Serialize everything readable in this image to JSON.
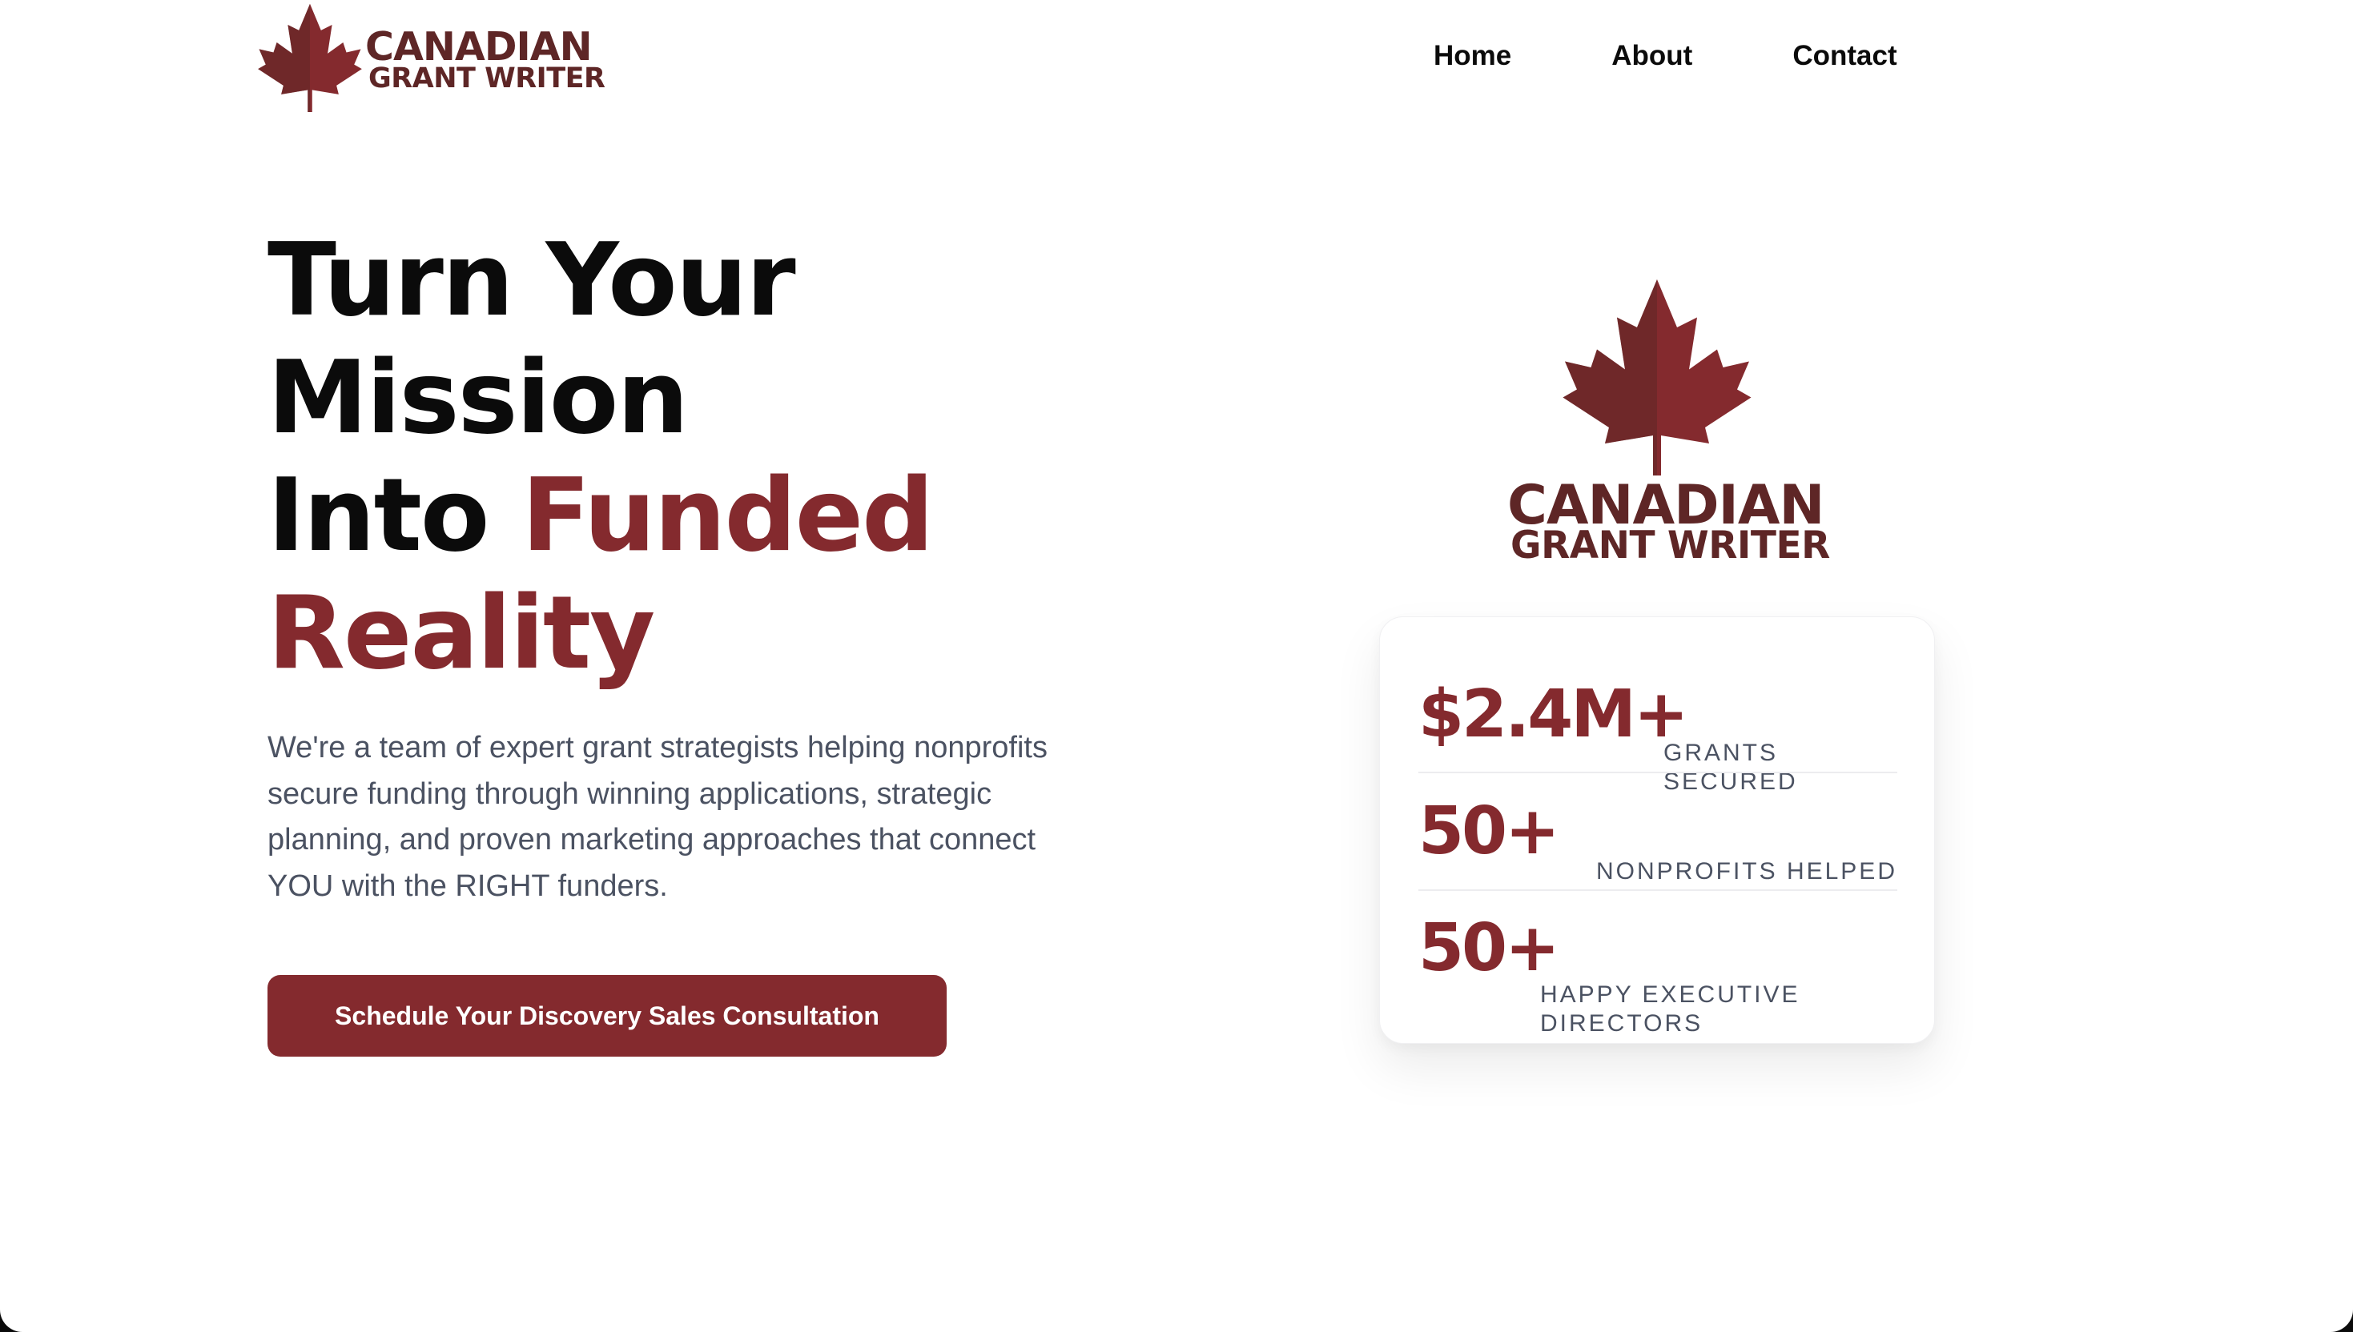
{
  "brand": {
    "name_line1": "CANADIAN",
    "name_line2": "GRANT WRITER",
    "accent_color": "#842a2e",
    "dark_red": "#5e2626",
    "icon": "maple-leaf-icon"
  },
  "nav": {
    "items": [
      {
        "label": "Home"
      },
      {
        "label": "About"
      },
      {
        "label": "Contact"
      }
    ]
  },
  "hero": {
    "title_line1": "Turn Your",
    "title_line2": "Mission",
    "title_line3_prefix": "Into ",
    "title_line3_accent": "Funded",
    "title_line4_accent": "Reality",
    "description": "We're a team of expert grant strategists helping nonprofits secure funding through winning applications, strategic planning, and proven marketing approaches that connect YOU with the RIGHT funders.",
    "cta_label": "Schedule Your Discovery Sales Consultation"
  },
  "stats": [
    {
      "value": "$2.4M+",
      "label": "GRANTS SECURED"
    },
    {
      "value": "50+",
      "label": "NONPROFITS HELPED"
    },
    {
      "value": "50+",
      "label": "HAPPY EXECUTIVE DIRECTORS"
    }
  ]
}
